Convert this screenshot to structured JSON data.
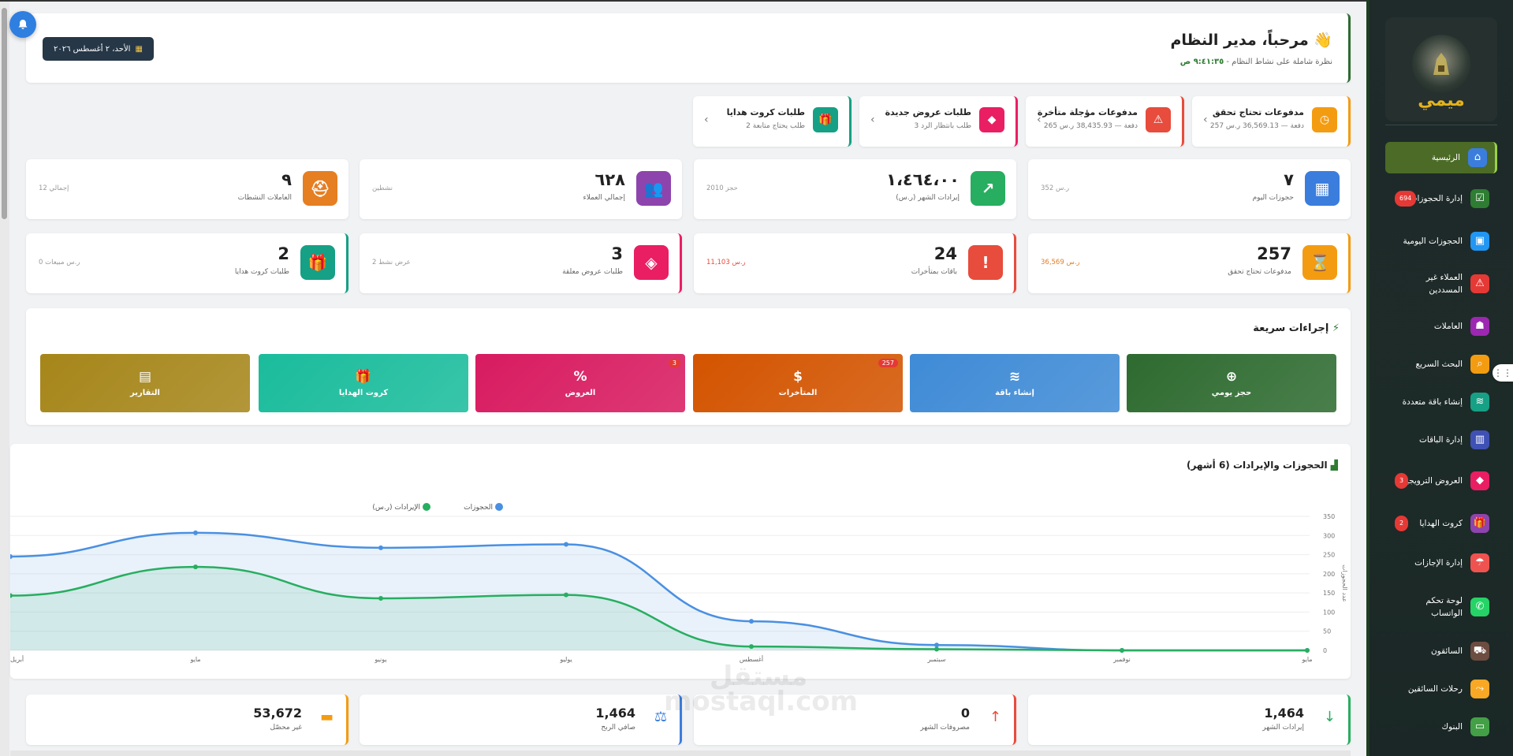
{
  "header": {
    "title": "مرحباً، مدير النظام 👋",
    "subtitle": "نظرة شاملة على نشاط النظام - ",
    "time": "٩:٤١:٣٥ ص",
    "date": "الأحد، ٢ أغسطس ٢٠٢٦"
  },
  "alerts": [
    {
      "title": "مدفوعات تحتاج تحقق",
      "sub": "257 دفعة — 36,569.13 ر.س",
      "color": "#f39c12",
      "icon": "clock-icon"
    },
    {
      "title": "مدفوعات مؤجلة متأخرة",
      "sub": "265 دفعة — 38,435.93 ر.س",
      "color": "#e74c3c",
      "icon": "warning-icon"
    },
    {
      "title": "طلبات عروض جديدة",
      "sub": "3 طلب بانتظار الرد",
      "color": "#e91e63",
      "icon": "tag-icon"
    },
    {
      "title": "طلبات كروت هدايا",
      "sub": "2 طلب يحتاج متابعة",
      "color": "#16a085",
      "icon": "gift-icon"
    }
  ],
  "stats_row1": [
    {
      "value": "٧",
      "label": "حجوزات اليوم",
      "extra": "352 ر.س",
      "color": "#3b7ddd",
      "icon": "calendar-icon"
    },
    {
      "value": "١،٤٦٤،٠٠",
      "label": "إيرادات الشهر (ر.س)",
      "extra": "2010 حجز",
      "color": "#27ae60",
      "icon": "chart-line-icon"
    },
    {
      "value": "٦٢٨",
      "label": "إجمالي العملاء",
      "extra": "نشطين",
      "color": "#8e44ad",
      "icon": "users-icon"
    },
    {
      "value": "٩",
      "label": "العاملات النشطات",
      "extra": "إجمالي 12",
      "color": "#e67e22",
      "icon": "helmet-icon"
    }
  ],
  "stats_row2": [
    {
      "value": "257",
      "label": "مدفوعات تحتاج تحقق",
      "extra": "36,569 ر.س",
      "color": "#f39c12",
      "icon": "hourglass-icon"
    },
    {
      "value": "24",
      "label": "باقات بمتأخرات",
      "extra": "11,103 ر.س",
      "color": "#e74c3c",
      "icon": "alert-circle-icon"
    },
    {
      "value": "3",
      "label": "طلبات عروض معلقة",
      "extra": "2 عرض نشط",
      "color": "#e91e63",
      "icon": "tags-icon"
    },
    {
      "value": "2",
      "label": "طلبات كروت هدايا",
      "extra": "0 ر.س مبيعات",
      "color": "#16a085",
      "icon": "gift-icon"
    }
  ],
  "quick": {
    "title": "إجراءات سريعة",
    "actions": [
      {
        "label": "حجز يومي",
        "badge": "",
        "color": "#2e6b30",
        "icon": "plus-circle-icon"
      },
      {
        "label": "إنشاء باقة",
        "badge": "",
        "color": "#3f8bd6",
        "icon": "layers-icon"
      },
      {
        "label": "المتأخرات",
        "badge": "257",
        "color": "#d35400",
        "icon": "hand-money-icon"
      },
      {
        "label": "العروض",
        "badge": "3",
        "color": "#d81b60",
        "icon": "percent-icon"
      },
      {
        "label": "كروت الهدايا",
        "badge": "",
        "color": "#1abc9c",
        "icon": "gift-icon"
      },
      {
        "label": "التقارير",
        "badge": "",
        "color": "#a6861a",
        "icon": "report-icon"
      }
    ]
  },
  "chart_title": "الحجوزات والإيرادات (6 أشهر)",
  "chart_data": {
    "type": "line",
    "categories": [
      "أبريل",
      "مايو",
      "يونيو",
      "يوليو",
      "أغسطس",
      "سبتمبر",
      "نوفمبر",
      "مايو"
    ],
    "series": [
      {
        "name": "الحجوزات",
        "color": "#4a90e2",
        "values": [
          245,
          307,
          268,
          277,
          76,
          14,
          0,
          0
        ]
      },
      {
        "name": "الإيرادات (ر.س)",
        "color": "#27ae60",
        "values": [
          143,
          218,
          136,
          145,
          10,
          3,
          0,
          0
        ]
      }
    ],
    "ylabel": "عدد الحجوزات",
    "ylim": [
      0,
      350
    ],
    "yticks": [
      0,
      50,
      100,
      150,
      200,
      250,
      300,
      350
    ],
    "legend": "top-center"
  },
  "bottom": [
    {
      "value": "1,464",
      "label": "إيرادات الشهر",
      "icon": "arrow-down-icon",
      "glyph": "↓",
      "color": "#27ae60"
    },
    {
      "value": "0",
      "label": "مصروفات الشهر",
      "icon": "arrow-up-icon",
      "glyph": "↑",
      "color": "#e74c3c"
    },
    {
      "value": "1,464",
      "label": "صافي الربح",
      "icon": "balance-icon",
      "glyph": "⚖",
      "color": "#3b7ddd"
    },
    {
      "value": "53,672",
      "label": "غير محصّل",
      "icon": "wallet-icon",
      "glyph": "▬",
      "color": "#f39c12"
    }
  ],
  "sidebar": {
    "brand": "ميمي",
    "items": [
      {
        "label": "الرئيسية",
        "icon": "home-icon",
        "color": "#3b7ddd",
        "badge": "",
        "active": true
      },
      {
        "label": "إدارة الحجوزات",
        "icon": "calendar-check-icon",
        "color": "#2e7d32",
        "badge": "694",
        "active": false
      },
      {
        "label": "الحجوزات اليومية",
        "icon": "calendar-day-icon",
        "color": "#2196f3",
        "badge": "",
        "active": false
      },
      {
        "label": "العملاء غير المسددين",
        "icon": "warning-icon",
        "color": "#e53935",
        "badge": "",
        "active": false
      },
      {
        "label": "العاملات",
        "icon": "worker-icon",
        "color": "#9c27b0",
        "badge": "",
        "active": false
      },
      {
        "label": "البحث السريع",
        "icon": "search-icon",
        "color": "#f39c12",
        "badge": "",
        "active": false
      },
      {
        "label": "إنشاء باقة متعددة",
        "icon": "layers-icon",
        "color": "#16a085",
        "badge": "",
        "active": false
      },
      {
        "label": "إدارة الباقات",
        "icon": "boxes-icon",
        "color": "#3f51b5",
        "badge": "",
        "active": false
      },
      {
        "label": "العروض الترويجية",
        "icon": "tag-icon",
        "color": "#e91e63",
        "badge": "3",
        "active": false
      },
      {
        "label": "كروت الهدايا",
        "icon": "gift-icon",
        "color": "#8e44ad",
        "badge": "2",
        "active": false
      },
      {
        "label": "إدارة الإجازات",
        "icon": "beach-icon",
        "color": "#ef5350",
        "badge": "",
        "active": false
      },
      {
        "label": "لوحة تحكم الواتساب",
        "icon": "whatsapp-icon",
        "color": "#25d366",
        "badge": "",
        "active": false
      },
      {
        "label": "السائقون",
        "icon": "car-icon",
        "color": "#6d4c41",
        "badge": "",
        "active": false
      },
      {
        "label": "رحلات السائقين",
        "icon": "route-icon",
        "color": "#f9a825",
        "badge": "",
        "active": false
      },
      {
        "label": "البنوك",
        "icon": "bank-icon",
        "color": "#43a047",
        "badge": "",
        "active": false
      }
    ]
  },
  "watermark": "مستقل mostaql.com"
}
